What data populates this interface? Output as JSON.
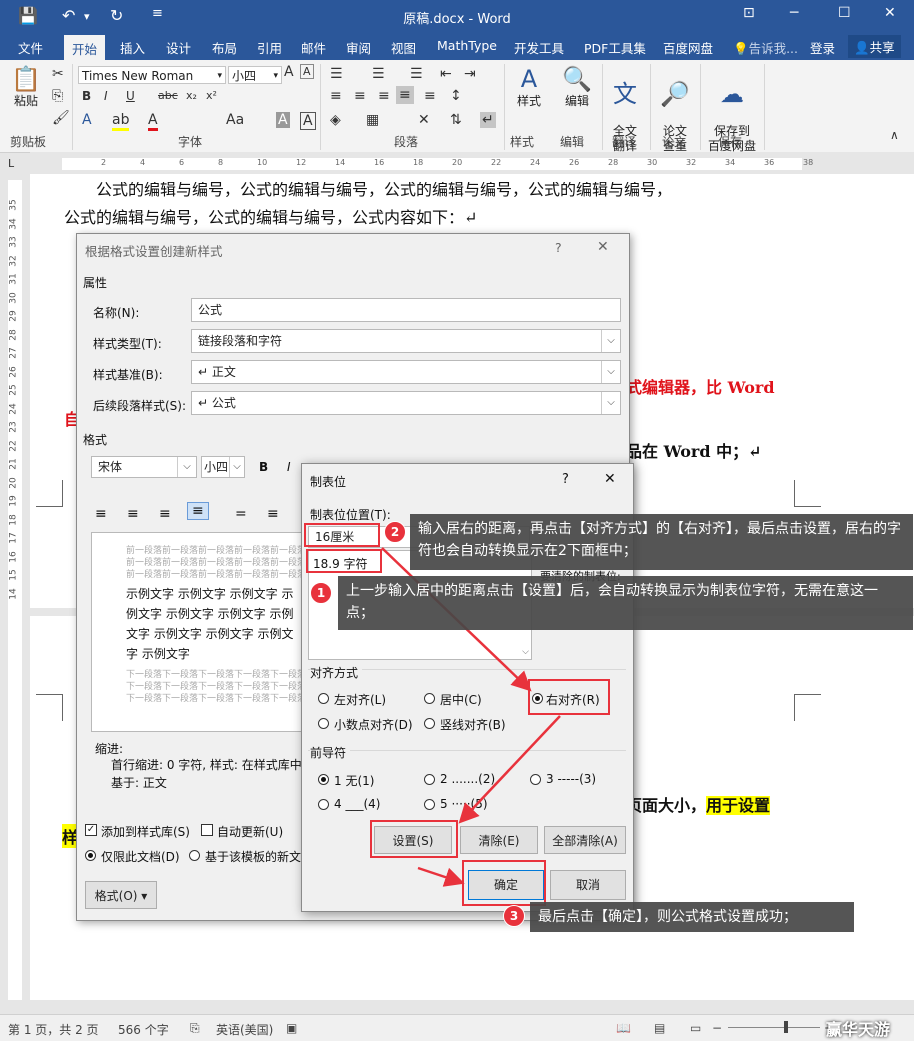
{
  "window": {
    "title": "原稿.docx - Word",
    "controls": {
      "min": "─",
      "max": "☐",
      "close": "✕",
      "ribbon_opts": "⊡"
    }
  },
  "quick_access": {
    "save": "💾",
    "undo": "↶",
    "undo_more": "▾",
    "redo": "↻",
    "customize": "≡"
  },
  "tabs": [
    "文件",
    "开始",
    "插入",
    "设计",
    "布局",
    "引用",
    "邮件",
    "审阅",
    "视图",
    "MathType",
    "开发工具",
    "PDF工具集",
    "百度网盘"
  ],
  "tell_me": "告诉我...",
  "login": "登录",
  "share": "共享",
  "ribbon": {
    "groups": [
      "剪贴板",
      "字体",
      "段落",
      "样式",
      "编辑",
      "翻译",
      "论文",
      "保存"
    ],
    "paste": "粘贴",
    "font_name": "Times New Roman",
    "font_size": "小四",
    "styles": "样式",
    "edit": "编辑",
    "translate": "全文\n翻译",
    "paper": "论文\n查重",
    "save_baidu": "保存到\n百度网盘"
  },
  "document": {
    "line0": "公式的编辑与编号，公式的编辑与编号，公式的编辑与编号，公式的编辑与编号，",
    "line1": "公式的编辑与编号，公式的编辑与编号，公式内容如下：↵",
    "red_frag": "式编辑器，比 Word",
    "red_left": "自",
    "word_frag": "品在 Word 中；↵",
    "page_frag_plain": "页面大小，",
    "page_frag_hl": "用于设置",
    "left_hl": "样"
  },
  "dialog_style": {
    "title": "根据格式设置创建新样式",
    "help": "?",
    "close": "✕",
    "section_props": "属性",
    "name_label": "名称(N):",
    "name_value": "公式",
    "type_label": "样式类型(T):",
    "type_value": "链接段落和字符",
    "base_label": "样式基准(B):",
    "base_value": "↵ 正文",
    "next_label": "后续段落样式(S):",
    "next_value": "↵ 公式",
    "section_format": "格式",
    "font_value": "宋体",
    "size_value": "小四",
    "bold": "B",
    "italic": "I",
    "preview_prev": "前一段落前一段落前一段落前一段落前一段落",
    "preview_sample": [
      "示例文字 示例文字 示例文字 示",
      "例文字 示例文字 示例文字 示例",
      "文字 示例文字 示例文字 示例文",
      "字 示例文字"
    ],
    "preview_next": "下一段落下一段落下一段落下一段落下一段落",
    "desc": [
      "缩进:",
      "首行缩进: 0 字符, 样式: 在样式库中",
      "基于: 正文"
    ],
    "add_gallery": "添加到样式库(S)",
    "auto_update": "自动更新(U)",
    "only_doc": "仅限此文档(D)",
    "template_based": "基于该模板的新文",
    "format_btn": "格式(O) ▾"
  },
  "dialog_tabs": {
    "title": "制表位",
    "help": "?",
    "close": "✕",
    "pos_label": "制表位位置(T):",
    "pos_value": "16厘米",
    "list_item": "18.9 字符",
    "clear_label": "要清除的制表位:",
    "align_label": "对齐方式",
    "align": {
      "left": "左对齐(L)",
      "center": "居中(C)",
      "right": "右对齐(R)",
      "decimal": "小数点对齐(D)",
      "bar": "竖线对齐(B)"
    },
    "leader_label": "前导符",
    "leader": {
      "l1": "1 无(1)",
      "l2": "2 .......(2)",
      "l3": "3 -----(3)",
      "l4": "4 ___(4)",
      "l5": "5 ·····(5)"
    },
    "btn_set": "设置(S)",
    "btn_clear": "清除(E)",
    "btn_clear_all": "全部清除(A)",
    "btn_ok": "确定",
    "btn_cancel": "取消"
  },
  "annotations": {
    "c1": "上一步输入居中的距离点击【设置】后，会自动转换显示为制表位字符，无需在意这一点；",
    "c2": "输入居右的距离，再点击【对齐方式】的【右对齐】，最后点击设置，居右的字符也会自动转换显示在2下面框中；",
    "c3": "最后点击【确定】，则公式格式设置成功；",
    "b1": "1",
    "b2": "2",
    "b3": "3"
  },
  "status": {
    "page": "第 1 页，共 2 页",
    "words": "566 个字",
    "lang": "英语(美国)",
    "zoom_minus": "−",
    "zoom_plus": "+",
    "watermark": "赢华天游"
  },
  "colors": {
    "accent": "#2b579a",
    "annotation_red": "#e8323c",
    "highlight": "#ffff00",
    "doc_red": "#e0131b"
  }
}
